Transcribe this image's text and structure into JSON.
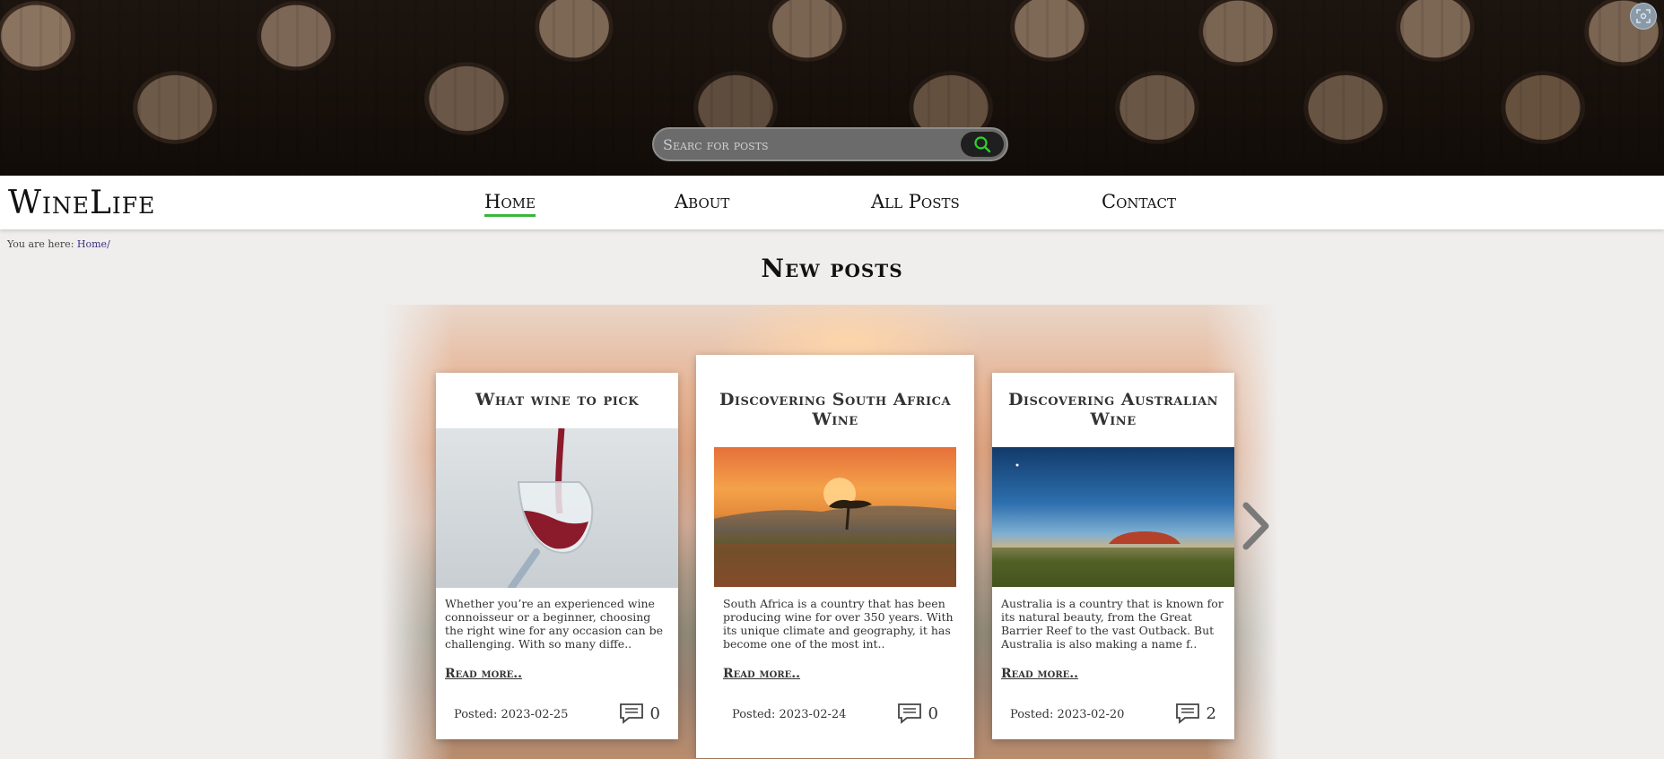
{
  "search": {
    "placeholder": "Searc for posts"
  },
  "brand": {
    "logo": "WineLife"
  },
  "nav": {
    "items": [
      {
        "label": "Home"
      },
      {
        "label": "About"
      },
      {
        "label": "All Posts"
      },
      {
        "label": "Contact"
      }
    ]
  },
  "breadcrumb": {
    "prefix": "You are here:",
    "home": "Home",
    "separator": "/"
  },
  "section": {
    "title": "New posts"
  },
  "posts": [
    {
      "title": "What wine to pick",
      "excerpt": "Whether you’re an experienced wine connoisseur or a beginner, choosing the right wine for any occasion can be challenging. With so many diffe..",
      "read_more": "Read more..",
      "posted": "Posted: 2023-02-25",
      "comments": "0"
    },
    {
      "title": "Discovering South Africa Wine",
      "excerpt": "South Africa is a country that has been producing wine for over 350 years. With its unique climate and geography, it has become one of the most int..",
      "read_more": "Read more..",
      "posted": "Posted: 2023-02-24",
      "comments": "0"
    },
    {
      "title": "Discovering Australian Wine",
      "excerpt": "Australia is a country that is known for its natural beauty, from the Great Barrier Reef to the vast Outback. But Australia is also making a name f..",
      "read_more": "Read more..",
      "posted": "Posted: 2023-02-20",
      "comments": "2"
    }
  ],
  "colors": {
    "accent": "#3cb43c",
    "search_icon": "#2fd02f"
  },
  "icons": {
    "search": "search-icon",
    "comments": "comment-icon",
    "next": "chevron-right-icon",
    "corner": "screenshot-icon"
  }
}
